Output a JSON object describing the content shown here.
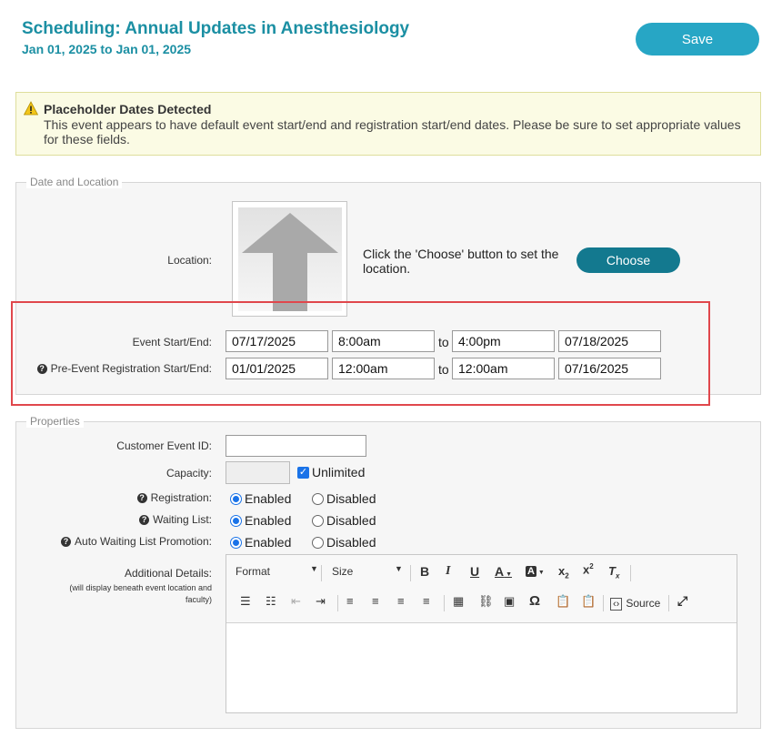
{
  "header": {
    "title": "Scheduling: Annual Updates in Anesthesiology",
    "subtitle": "Jan 01, 2025 to Jan 01, 2025",
    "save_label": "Save"
  },
  "alert": {
    "title": "Placeholder Dates Detected",
    "text": "This event appears to have default event start/end and registration start/end dates. Please be sure to set appropriate values for these fields."
  },
  "date_location": {
    "legend": "Date and Location",
    "location_label": "Location:",
    "location_message": "Click the 'Choose' button to set the location.",
    "choose_label": "Choose",
    "event_label": "Event Start/End:",
    "event_start_date": "07/17/2025",
    "event_start_time": "8:00am",
    "event_end_time": "4:00pm",
    "event_end_date": "07/18/2025",
    "reg_label": "Pre-Event Registration Start/End:",
    "reg_start_date": "01/01/2025",
    "reg_start_time": "12:00am",
    "reg_end_time": "12:00am",
    "reg_end_date": "07/16/2025",
    "to": "to"
  },
  "properties": {
    "legend": "Properties",
    "customer_id_label": "Customer Event ID:",
    "customer_id_value": "",
    "capacity_label": "Capacity:",
    "unlimited_label": "Unlimited",
    "registration_label": "Registration:",
    "waiting_list_label": "Waiting List:",
    "auto_promo_label": "Auto Waiting List Promotion:",
    "enabled": "Enabled",
    "disabled": "Disabled",
    "details_label": "Additional Details:",
    "details_note": "(will display beneath event location and faculty)"
  },
  "editor": {
    "format_label": "Format",
    "size_label": "Size",
    "source_label": "Source"
  },
  "colors": {
    "accent": "#1b8fa3",
    "save_button": "#27a6c5",
    "choose_button": "#13798f",
    "highlight_border": "#e0474c"
  }
}
